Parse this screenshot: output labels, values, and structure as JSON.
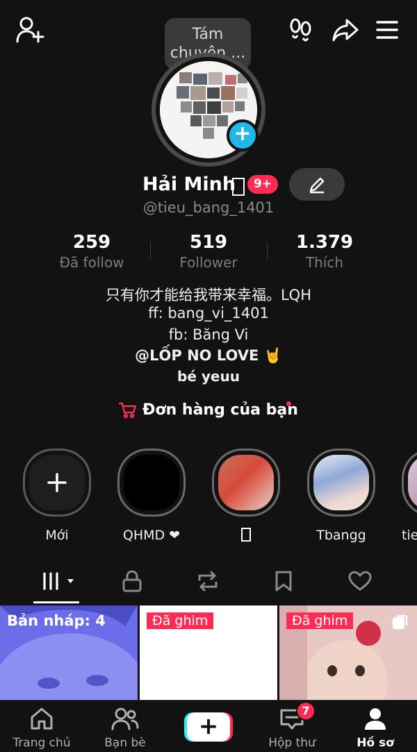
{
  "header": {
    "note": "Tám chuyện ...",
    "icons": [
      "add-friend-icon",
      "footprint-icon",
      "share-icon",
      "menu-icon"
    ]
  },
  "profile": {
    "display_name": "Hải Minh",
    "name_glyph": "",
    "badge": "9+",
    "username": "@tieu_bang_1401",
    "avatar_plus": "+"
  },
  "stats": [
    {
      "value": "259",
      "label": "Đã follow"
    },
    {
      "value": "519",
      "label": "Follower"
    },
    {
      "value": "1.379",
      "label": "Thích"
    }
  ],
  "bio": {
    "line1": "只有你才能给我带来幸福。LQH",
    "line2": "ff: bang_vi_1401",
    "line3": "fb: Băng Vi",
    "line4": "@LỐP NO LOVE 🤘",
    "line5": "bé yeuu"
  },
  "orders": {
    "label": "Đơn hàng của bạn"
  },
  "highlights": [
    {
      "label": "Mới"
    },
    {
      "label": "QHMD ❤"
    },
    {
      "label": ""
    },
    {
      "label": "Tbangg"
    },
    {
      "label": "tie"
    }
  ],
  "tabs": [
    "videos-tab",
    "private-tab",
    "repost-tab",
    "saved-tab",
    "liked-tab"
  ],
  "videos": [
    {
      "tag": "Bản nháp: 4"
    },
    {
      "tag": "Đã ghim"
    },
    {
      "tag": "Đã ghim"
    }
  ],
  "nav": {
    "home": "Trang chủ",
    "friends": "Bạn bè",
    "create": "+",
    "inbox": "Hộp thư",
    "inbox_badge": "7",
    "profile": "Hồ sơ"
  },
  "colors": {
    "background": "#121212",
    "accent": "#fe2c55",
    "cyan": "#20b8e6"
  }
}
